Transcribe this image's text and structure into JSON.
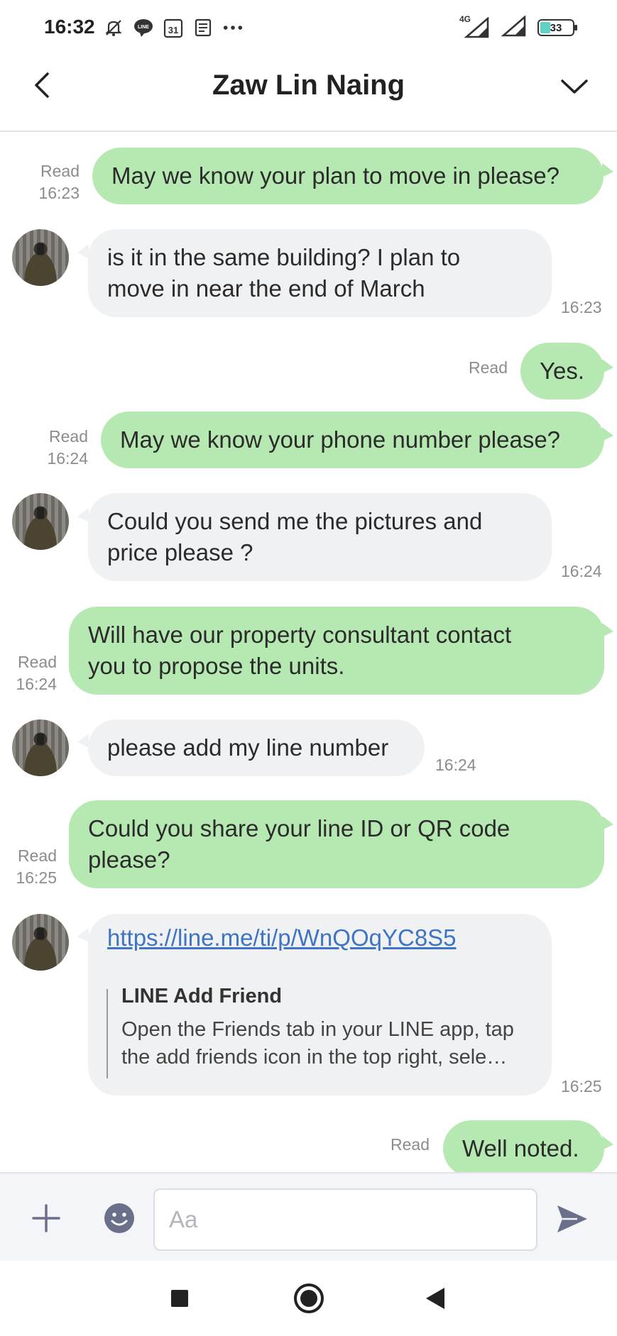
{
  "status_bar": {
    "time": "16:32",
    "calendar_day": "31",
    "network": "4G",
    "battery": "33",
    "icons": [
      "mute-bell-icon",
      "line-app-icon",
      "calendar-icon",
      "news-icon",
      "more-dots-icon",
      "signal-icon",
      "signal-icon",
      "battery-icon"
    ]
  },
  "header": {
    "title": "Zaw Lin Naing",
    "back_icon": "chevron-left-icon",
    "menu_icon": "chevron-down-icon"
  },
  "messages": [
    {
      "dir": "out",
      "text": "May we know your plan to move in please?",
      "read": "Read",
      "time": "16:23"
    },
    {
      "dir": "in",
      "lines": [
        "is it in the same building? I plan to",
        "move in near the end of March"
      ],
      "time": "16:23"
    },
    {
      "dir": "out",
      "text": "Yes.",
      "read": "Read"
    },
    {
      "dir": "out",
      "text": "May we know your phone number please?",
      "read": "Read",
      "time": "16:24"
    },
    {
      "dir": "in",
      "lines": [
        "Could you send me the pictures and",
        "price please ?"
      ],
      "time": "16:24"
    },
    {
      "dir": "out",
      "lines": [
        "Will have our property consultant contact",
        "you to propose the units."
      ],
      "read": "Read",
      "time": "16:24"
    },
    {
      "dir": "in",
      "text": "please add my line number",
      "time": "16:24"
    },
    {
      "dir": "out",
      "lines": [
        "Could you share your line ID or QR code",
        "please?"
      ],
      "read": "Read",
      "time": "16:25"
    },
    {
      "dir": "in",
      "link": "https://line.me/ti/p/WnQOqYC8S5",
      "card_title": "LINE Add Friend",
      "card_lines": [
        "Open the Friends tab in your LINE app, tap",
        "the add friends icon in the top right, sele…"
      ],
      "time": "16:25"
    },
    {
      "dir": "out",
      "text": "Well noted.",
      "read": "Read"
    }
  ],
  "input_bar": {
    "placeholder": "Aa",
    "plus_icon": "plus-icon",
    "emoji_icon": "emoji-icon",
    "send_icon": "send-icon"
  },
  "nav_bar": {
    "icons": [
      "recents-square-icon",
      "home-circle-icon",
      "back-triangle-icon"
    ]
  },
  "colors": {
    "outgoing_bubble": "#b6e9b1",
    "incoming_bubble": "#f0f1f3",
    "link": "#3f73c4",
    "meta_text": "#8b8b90"
  }
}
